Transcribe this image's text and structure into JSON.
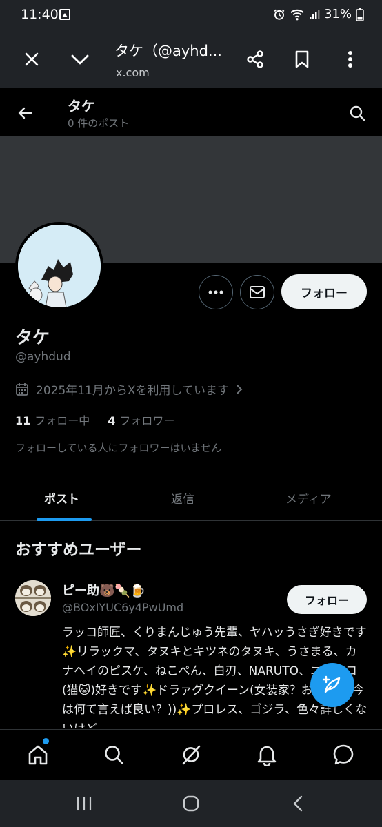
{
  "status_bar": {
    "time": "11:40",
    "battery": "31%",
    "icons": [
      "image-icon",
      "alarm-icon",
      "wifi-icon",
      "signal-icon",
      "battery-icon"
    ]
  },
  "browser": {
    "title": "タケ（@ayhd...",
    "url": "x.com",
    "icons": [
      "close-icon",
      "chevron-down-icon",
      "share-icon",
      "bookmark-icon",
      "more-vertical-icon"
    ]
  },
  "header": {
    "name": "タケ",
    "post_count": "0 件のポスト"
  },
  "profile": {
    "name": "タケ",
    "handle": "@ayhdud",
    "joined": "2025年11月からXを利用しています",
    "following_count": "11",
    "following_label": "フォロー中",
    "followers_count": "4",
    "followers_label": "フォロワー",
    "followers_note": "フォローしている人にフォロワーはいません",
    "follow_button": "フォロー"
  },
  "tabs": [
    {
      "label": "ポスト",
      "active": true
    },
    {
      "label": "返信",
      "active": false
    },
    {
      "label": "メディア",
      "active": false
    }
  ],
  "recommended": {
    "title": "おすすめユーザー",
    "users": [
      {
        "name": "ピー助🐻🍡🍺",
        "handle": "@BOxIYUC6y4PwUmd",
        "follow_label": "フォロー",
        "bio": "ラッコ師匠、くりまんじゅう先輩、ヤハッうさぎ好きです✨リラックマ、タヌキとキツネのタヌキ、うさまる、カナヘイのピスケ、ねこぺん、白刃、NARUTO、ニャンコ(猫🐱)好きです✨ドラァグクイーン(女装家？おネエ？(今は何て言えば良い？))✨プロレス、ゴジラ、色々詳しくないけど"
      }
    ]
  },
  "bottom_nav": [
    "home-icon",
    "search-icon",
    "grok-icon",
    "notifications-icon",
    "messages-icon"
  ],
  "colors": {
    "accent": "#1d9bf0",
    "background": "#000000",
    "banner": "#333639",
    "text_primary": "#e7e9ea",
    "text_secondary": "#71767b",
    "chrome": "#202327"
  }
}
